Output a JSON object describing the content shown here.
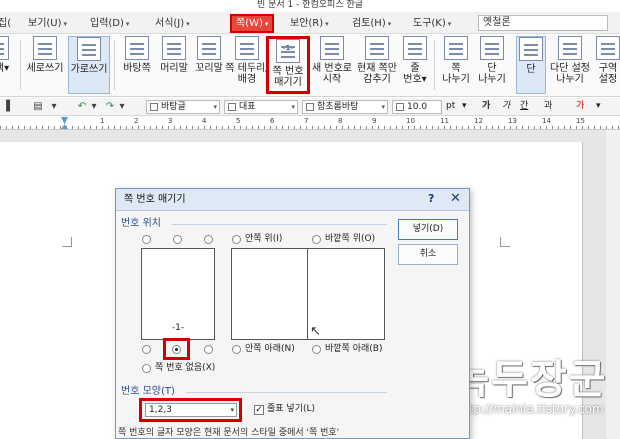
{
  "window": {
    "title": "빈 문서 1 - 한컴오피스 한글"
  },
  "menu": {
    "items": [
      {
        "label": "집("
      },
      {
        "label": "보기(U)"
      },
      {
        "label": "입력(D)"
      },
      {
        "label": "서식(J)"
      },
      {
        "label": "쪽(W)"
      },
      {
        "label": "보안(R)"
      },
      {
        "label": "검토(H)"
      },
      {
        "label": "도구(K)"
      }
    ],
    "font_value": "옛철론"
  },
  "ribbon": {
    "partial_left": "색▾",
    "buttons": [
      {
        "label": "세로쓰기"
      },
      {
        "label": "가로쓰기"
      },
      {
        "label": "바탕쪽"
      },
      {
        "label": "머리말"
      },
      {
        "label": "꼬리말"
      },
      {
        "label": "쪽 테두리/\n배경"
      },
      {
        "label": "쪽 번호\n매기기"
      },
      {
        "label": "새 번호로\n시작"
      },
      {
        "label": "현재 쪽만\n감추기"
      },
      {
        "label": "줄\n번호▾"
      },
      {
        "label": "쪽\n나누기"
      },
      {
        "label": "단\n나누기"
      },
      {
        "label": "단"
      },
      {
        "label": "다단 설정\n나누기"
      },
      {
        "label": "구역\n설정"
      }
    ],
    "pagenum_glyph": "-1-"
  },
  "toolbar": {
    "style_box": "바탕글",
    "lang_box": "대표",
    "font_box": "함초롬바탕",
    "size_box": "10.0",
    "size_unit": "pt",
    "format_glyphs": [
      "가",
      "가",
      "간",
      "과",
      "가"
    ]
  },
  "ruler": {
    "labels": [
      "1",
      "2",
      "3",
      "4",
      "5",
      "6",
      "7",
      "8",
      "9",
      "10",
      "11",
      "12",
      "13",
      "14",
      "15"
    ]
  },
  "dialog": {
    "title": "쪽 번호 매기기",
    "help": "?",
    "close": "✕",
    "position_section": "번호 위치",
    "opt_inner_top": "안쪽 위(I)",
    "opt_outer_top": "바깥쪽 위(O)",
    "opt_inner_bottom": "안쪽 아래(N)",
    "opt_outer_bottom": "바깥쪽 아래(B)",
    "opt_none": "쪽 번호 없음(X)",
    "preview_number": "-1-",
    "format_section": "번호 모양(T)",
    "format_value": "1,2,3",
    "dash_check": "줄표 넣기(L)",
    "dash_checked": true,
    "insert_button": "넣기(D)",
    "cancel_button": "취소",
    "footer_note": "쪽 번호의 글자 모양은 현재 문서의 스타일 중에서 '쪽 번호'"
  },
  "watermark": {
    "title": "녹두장군",
    "url": "http://mainia.tistory.com"
  },
  "colors": {
    "highlight": "#d40000",
    "accent": "#2a4f8c"
  }
}
